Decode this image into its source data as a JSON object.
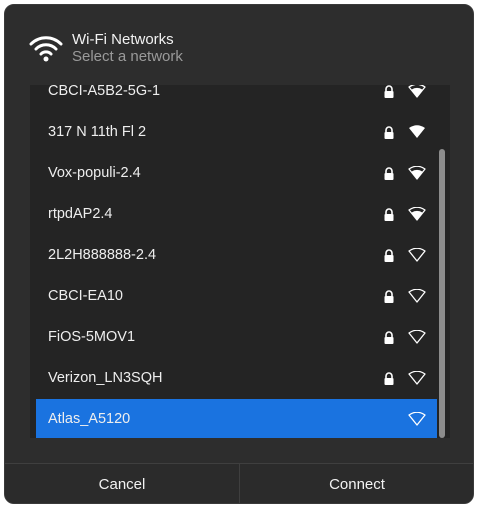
{
  "header": {
    "icon": "wifi-icon",
    "title": "Wi-Fi Networks",
    "subtitle": "Select a network"
  },
  "networks": [
    {
      "name": "CBCI-A5B2-5G-1",
      "secured": true,
      "signal": 3
    },
    {
      "name": "317 N 11th Fl 2",
      "secured": true,
      "signal": 4
    },
    {
      "name": "Vox-populi-2.4",
      "secured": true,
      "signal": 3
    },
    {
      "name": "rtpdAP2.4",
      "secured": true,
      "signal": 3
    },
    {
      "name": "2L2H888888-2.4",
      "secured": true,
      "signal": 0
    },
    {
      "name": "CBCI-EA10",
      "secured": true,
      "signal": 0
    },
    {
      "name": "FiOS-5MOV1",
      "secured": true,
      "signal": 0
    },
    {
      "name": "Verizon_LN3SQH",
      "secured": true,
      "signal": 0
    },
    {
      "name": "Atlas_A5120",
      "secured": false,
      "signal": 0,
      "selected": true
    }
  ],
  "footer": {
    "cancel_label": "Cancel",
    "connect_label": "Connect"
  },
  "colors": {
    "dialog_bg": "#2d2d2d",
    "list_bg": "#242424",
    "selection": "#1a73e0",
    "text": "#eeeeee",
    "subtitle": "#9a9a9a"
  }
}
